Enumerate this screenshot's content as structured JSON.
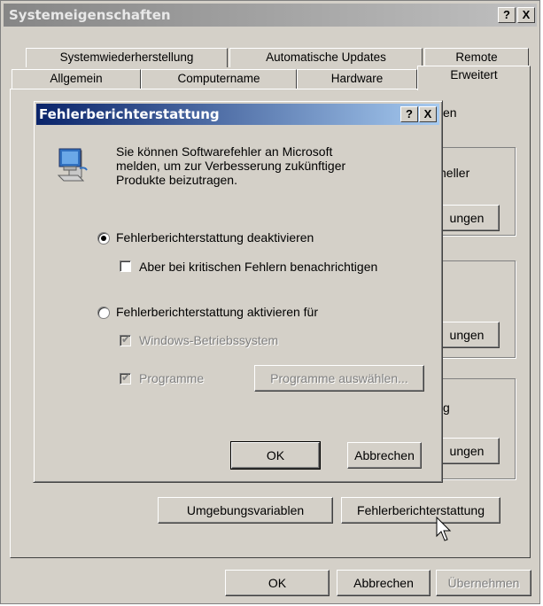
{
  "outer_window": {
    "title": "Systemeigenschaften",
    "help_btn": "?",
    "close_btn": "X",
    "tabs_row1": [
      "Systemwiederherstellung",
      "Automatische Updates",
      "Remote"
    ],
    "tabs_row2": [
      "Allgemein",
      "Computername",
      "Hardware",
      "Erweitert"
    ],
    "partial_texts": [
      "en",
      "neller",
      "ungen",
      "ungen",
      "g",
      "ungen"
    ],
    "env_button": "Umgebungsvariablen",
    "error_button": "Fehlerberichterstattung",
    "ok_button": "OK",
    "cancel_button": "Abbrechen",
    "apply_button": "Übernehmen"
  },
  "dialog": {
    "title": "Fehlerberichterstattung",
    "help_btn": "?",
    "close_btn": "X",
    "info_lines": [
      "Sie können Softwarefehler an Microsoft",
      "melden, um zur Verbesserung zukünftiger",
      "Produkte beizutragen."
    ],
    "radio_disable": "Fehlerberichterstattung deaktivieren",
    "radio_disable_selected": true,
    "check_critical": "Aber bei kritischen Fehlern benachrichtigen",
    "check_critical_checked": false,
    "radio_enable": "Fehlerberichterstattung aktivieren für",
    "radio_enable_selected": false,
    "check_windows": "Windows-Betriebssystem",
    "check_windows_checked": true,
    "check_programs": "Programme",
    "check_programs_checked": true,
    "select_programs_button": "Programme auswählen...",
    "ok_button": "OK",
    "cancel_button": "Abbrechen"
  },
  "icons": {
    "computer_icon": "computer-icon",
    "cursor": "mouse-pointer-icon"
  }
}
